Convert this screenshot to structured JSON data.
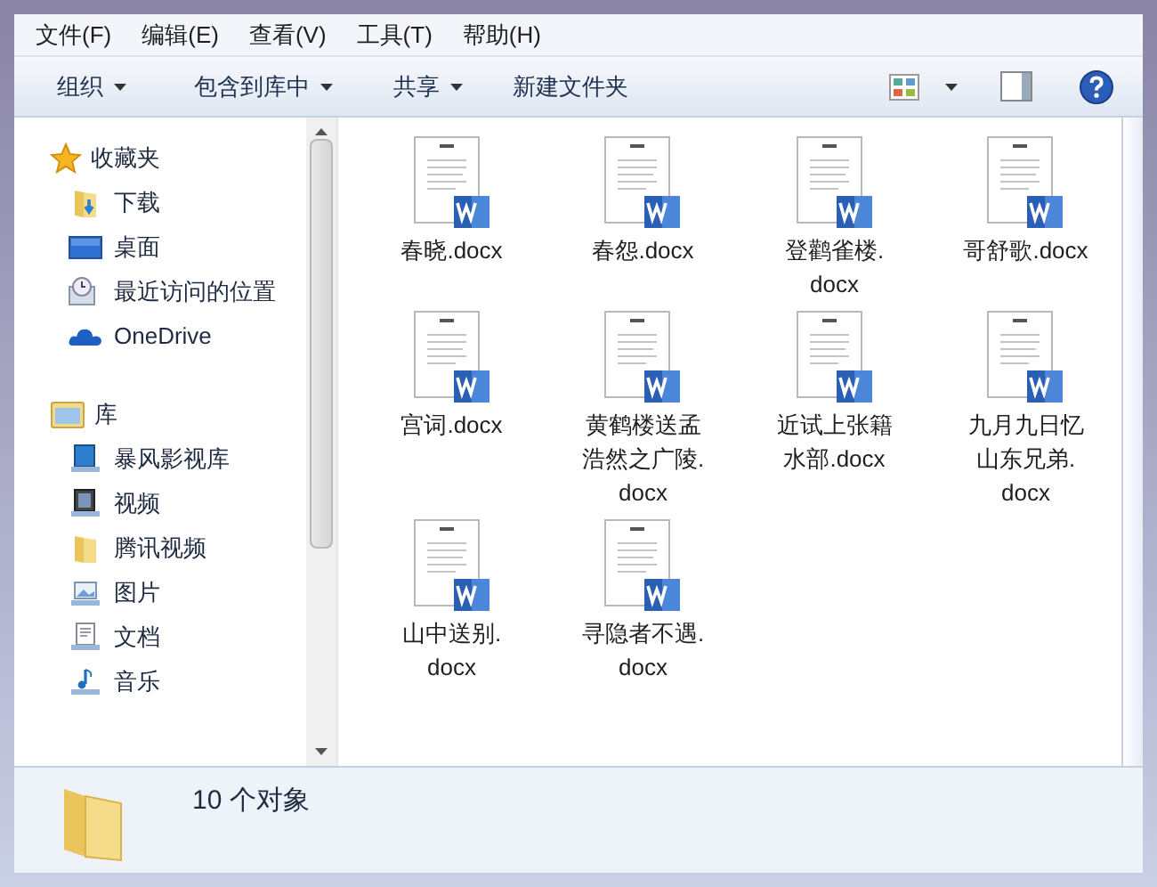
{
  "menu_bar": [
    "文件(F)",
    "编辑(E)",
    "查看(V)",
    "工具(T)",
    "帮助(H)"
  ],
  "toolbar": [
    {
      "label": "组织",
      "dropdown": true
    },
    {
      "label": "包含到库中",
      "dropdown": true
    },
    {
      "label": "共享",
      "dropdown": true
    },
    {
      "label": "新建文件夹",
      "dropdown": false
    }
  ],
  "navigation": [
    {
      "label": "收藏夹",
      "children": [
        {
          "label": "下载"
        },
        {
          "label": "桌面"
        },
        {
          "label": "最近访问的位置"
        },
        {
          "label": "OneDrive"
        }
      ]
    },
    {
      "label": "库",
      "children": [
        {
          "label": "暴风影视库"
        },
        {
          "label": "视频"
        },
        {
          "label": "腾讯视频"
        },
        {
          "label": "图片"
        },
        {
          "label": "文档"
        },
        {
          "label": "音乐"
        }
      ]
    }
  ],
  "files": [
    {
      "name": "春晓.docx"
    },
    {
      "name": "春怨.docx"
    },
    {
      "name": "登鹳雀楼.docx"
    },
    {
      "name": "哥舒歌.docx"
    },
    {
      "name": "宫词.docx"
    },
    {
      "name": "黄鹤楼送孟浩然之广陵.docx"
    },
    {
      "name": "近试上张籍水部.docx"
    },
    {
      "name": "九月九日忆山东兄弟.docx"
    },
    {
      "name": "山中送别.docx"
    },
    {
      "name": "寻隐者不遇.docx"
    }
  ],
  "status_bar": {
    "count": "10 个对象"
  }
}
